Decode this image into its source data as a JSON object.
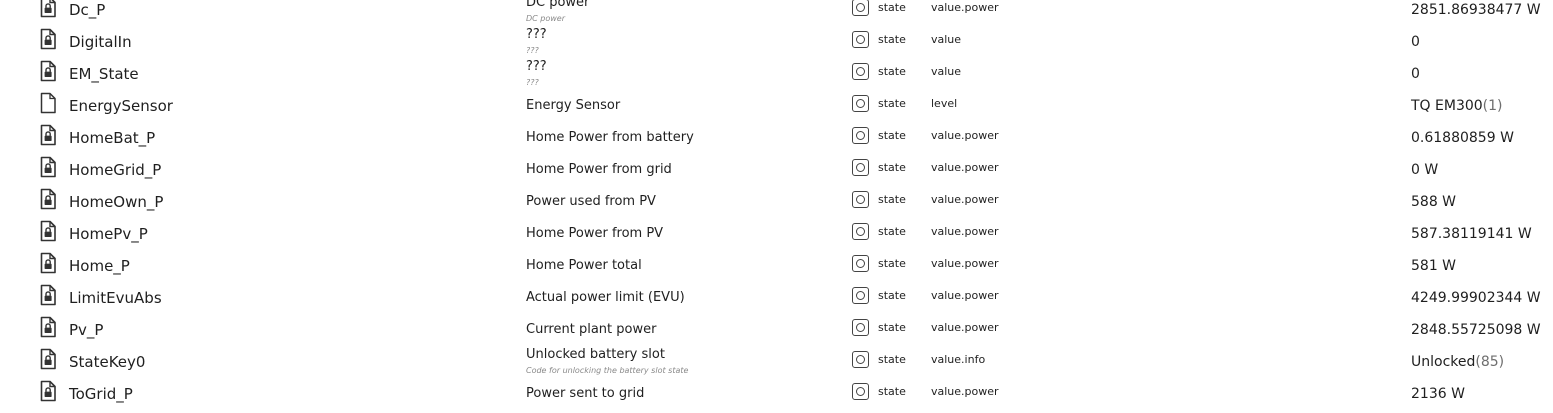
{
  "rows": [
    {
      "id": "Dc_P",
      "name": "DC power",
      "desc": "DC power",
      "type": "state",
      "role": "value.power",
      "value": "2851.86938477 W",
      "extra": "",
      "locked": true
    },
    {
      "id": "DigitalIn",
      "name": "???",
      "desc": "???",
      "type": "state",
      "role": "value",
      "value": "0",
      "extra": "",
      "locked": true
    },
    {
      "id": "EM_State",
      "name": "???",
      "desc": "???",
      "type": "state",
      "role": "value",
      "value": "0",
      "extra": "",
      "locked": true
    },
    {
      "id": "EnergySensor",
      "name": "Energy Sensor",
      "desc": "",
      "type": "state",
      "role": "level",
      "value": "TQ EM300",
      "extra": "(1)",
      "locked": false
    },
    {
      "id": "HomeBat_P",
      "name": "Home Power from battery",
      "desc": "",
      "type": "state",
      "role": "value.power",
      "value": "0.61880859 W",
      "extra": "",
      "locked": true
    },
    {
      "id": "HomeGrid_P",
      "name": "Home Power from grid",
      "desc": "",
      "type": "state",
      "role": "value.power",
      "value": "0 W",
      "extra": "",
      "locked": true
    },
    {
      "id": "HomeOwn_P",
      "name": "Power used from PV",
      "desc": "",
      "type": "state",
      "role": "value.power",
      "value": "588 W",
      "extra": "",
      "locked": true
    },
    {
      "id": "HomePv_P",
      "name": "Home Power from PV",
      "desc": "",
      "type": "state",
      "role": "value.power",
      "value": "587.38119141 W",
      "extra": "",
      "locked": true
    },
    {
      "id": "Home_P",
      "name": "Home Power total",
      "desc": "",
      "type": "state",
      "role": "value.power",
      "value": "581 W",
      "extra": "",
      "locked": true
    },
    {
      "id": "LimitEvuAbs",
      "name": "Actual power limit (EVU)",
      "desc": "",
      "type": "state",
      "role": "value.power",
      "value": "4249.99902344 W",
      "extra": "",
      "locked": true
    },
    {
      "id": "Pv_P",
      "name": "Current plant power",
      "desc": "",
      "type": "state",
      "role": "value.power",
      "value": "2848.55725098 W",
      "extra": "",
      "locked": true
    },
    {
      "id": "StateKey0",
      "name": "Unlocked battery slot",
      "desc": "Code for unlocking the battery slot state",
      "type": "state",
      "role": "value.info",
      "value": "Unlocked",
      "extra": "(85)",
      "locked": true
    },
    {
      "id": "ToGrid_P",
      "name": "Power sent to grid",
      "desc": "",
      "type": "state",
      "role": "value.power",
      "value": "2136 W",
      "extra": "",
      "locked": true
    }
  ],
  "colors": {
    "text": "#1f1f1f",
    "muted": "#8a8a8a",
    "icon": "#333333"
  },
  "icons": {
    "locked": "file-lock-icon",
    "unlocked": "file-icon",
    "type": "state-type-icon"
  }
}
